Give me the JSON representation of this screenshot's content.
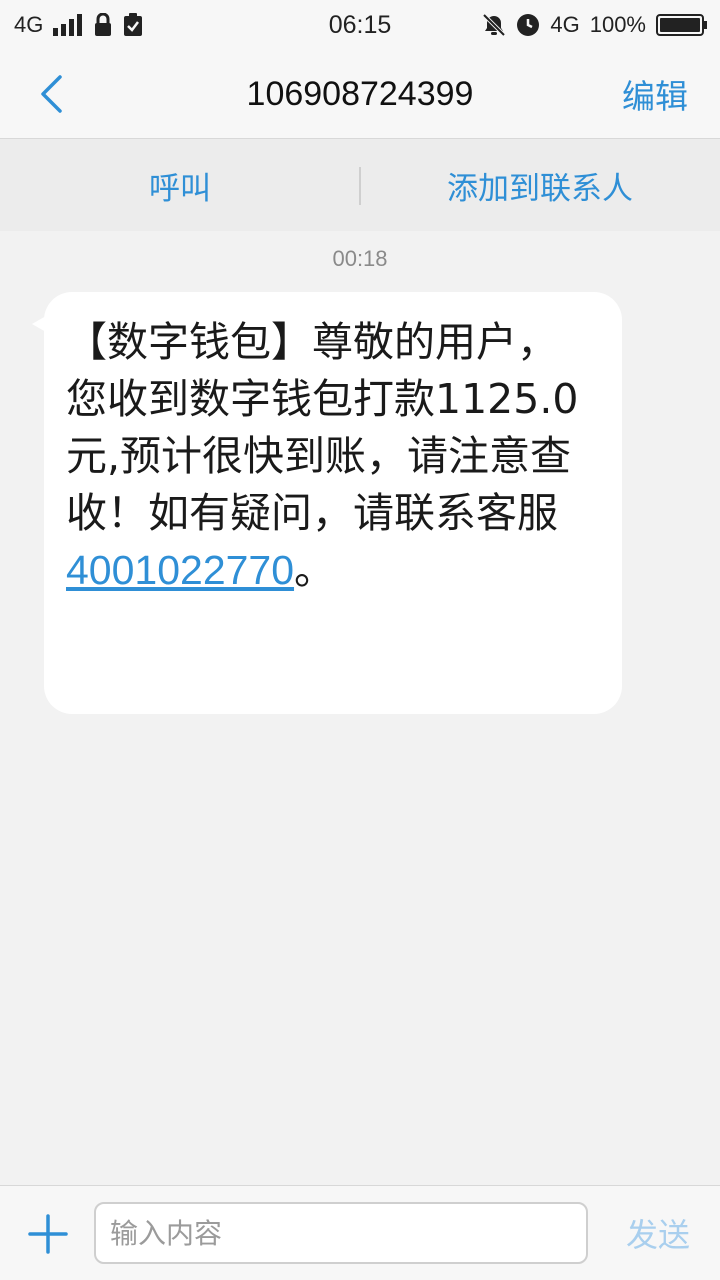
{
  "status_bar": {
    "network": "4G",
    "time": "06:15",
    "right_network": "4G",
    "battery": "100%",
    "battery_level": 1.0,
    "icons": [
      "signal-icon",
      "lock-icon",
      "clipboard-check-icon",
      "alarm-off-icon",
      "clock-icon",
      "battery-icon"
    ]
  },
  "header": {
    "back_icon": "chevron-left-icon",
    "title": "106908724399",
    "edit_label": "编辑"
  },
  "actions": {
    "call_label": "呼叫",
    "add_contact_label": "添加到联系人"
  },
  "conversation": {
    "messages": [
      {
        "time": "00:18",
        "text": "【数字钱包】尊敬的用户，您收到数字钱包打款1125.0元,预计很快到账，请注意查收！如有疑问，请联系客服",
        "phone_link": "4001022770",
        "suffix": "。"
      }
    ]
  },
  "composer": {
    "placeholder": "输入内容",
    "plus_icon": "plus-icon",
    "send_label": "发送"
  },
  "colors": {
    "accent": "#2f8fd6",
    "send_disabled": "#a9cfee",
    "background": "#f2f2f2",
    "bubble": "#ffffff"
  }
}
